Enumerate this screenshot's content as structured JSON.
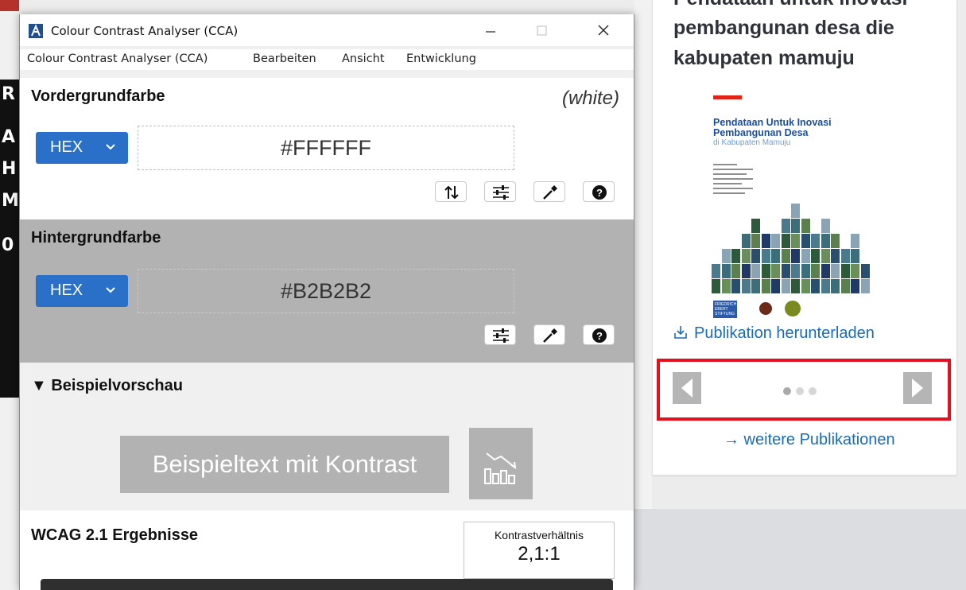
{
  "background_page": {
    "publication_title_cut": "Pendataan untuk inovasi",
    "publication_title": "pembangunan desa die kabupaten mamuju",
    "cover": {
      "title": "Pendataan Untuk Inovasi Pembangunan Desa",
      "subtitle": "di Kabupaten Mamuju"
    },
    "download_link": "Publikation herunterladen",
    "carousel": {
      "dots": 3,
      "active_index": 0
    },
    "more_link": "→ weitere Publikationen",
    "colors": {
      "link": "#1a6bb8",
      "highlight_border": "#e3111d"
    }
  },
  "window": {
    "title": "Colour Contrast Analyser (CCA)",
    "menu": [
      "Colour Contrast Analyser (CCA)",
      "Bearbeiten",
      "Ansicht",
      "Entwicklung"
    ]
  },
  "foreground": {
    "title": "Vordergrundfarbe",
    "color_name": "(white)",
    "format": "HEX",
    "hex": "#FFFFFF"
  },
  "background": {
    "title": "Hintergrundfarbe",
    "format": "HEX",
    "hex": "#B2B2B2"
  },
  "preview": {
    "title": "▼ Beispielvorschau",
    "sample_text": "Beispieltext mit Kontrast"
  },
  "results": {
    "title": "WCAG 2.1 Ergebnisse",
    "ratio_label": "Kontrastverhältnis",
    "ratio_value": "2,1:1"
  },
  "icons": [
    "swap-icon",
    "sliders-icon",
    "eyedropper-icon",
    "help-icon",
    "chart-icon",
    "download-icon",
    "chevron-left-icon",
    "chevron-right-icon"
  ]
}
